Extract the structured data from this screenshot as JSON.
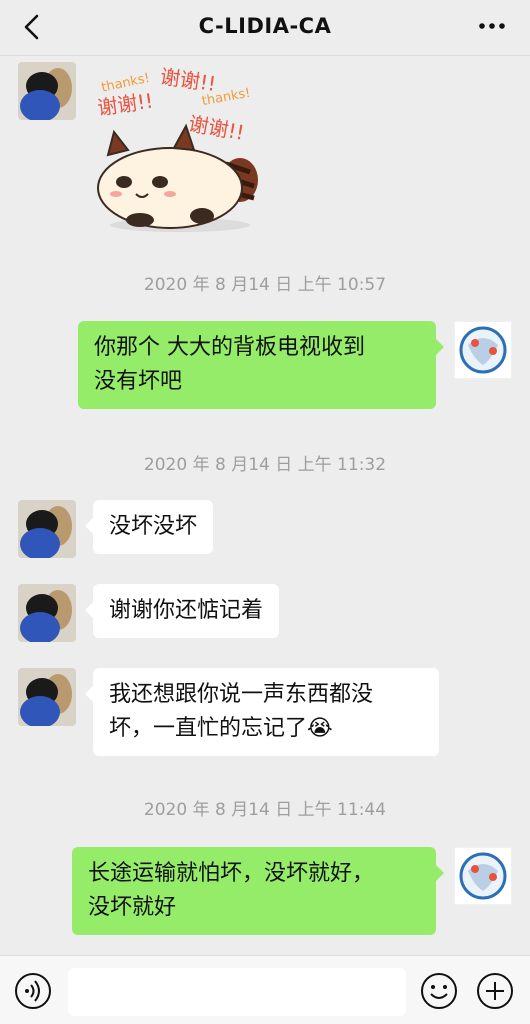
{
  "header": {
    "title": "C-LIDIA-CA"
  },
  "sticker": {
    "texts": [
      "thanks!",
      "谢谢!!",
      "谢谢!!",
      "thanks!",
      "谢谢!!"
    ]
  },
  "timestamps": [
    "2020 年 8 月14 日 上午 10:57",
    "2020 年 8 月14 日 上午 11:32",
    "2020 年 8 月14 日 上午 11:44"
  ],
  "messages": [
    {
      "side": "right",
      "lines": [
        "你那个  大大的背板电视收到",
        "没有坏吧"
      ]
    },
    {
      "side": "left",
      "lines": [
        "没坏没坏"
      ]
    },
    {
      "side": "left",
      "lines": [
        "谢谢你还惦记着"
      ]
    },
    {
      "side": "left",
      "lines": [
        "我还想跟你说一声东西都没",
        "坏，一直忙的忘记了"
      ],
      "emoji": "😭"
    },
    {
      "side": "right",
      "lines": [
        "长途运输就怕坏，没坏就好，",
        "没坏就好"
      ]
    }
  ],
  "colors": {
    "bubble_sent": "#95ec69",
    "bubble_received": "#ffffff",
    "background": "#ededed"
  }
}
